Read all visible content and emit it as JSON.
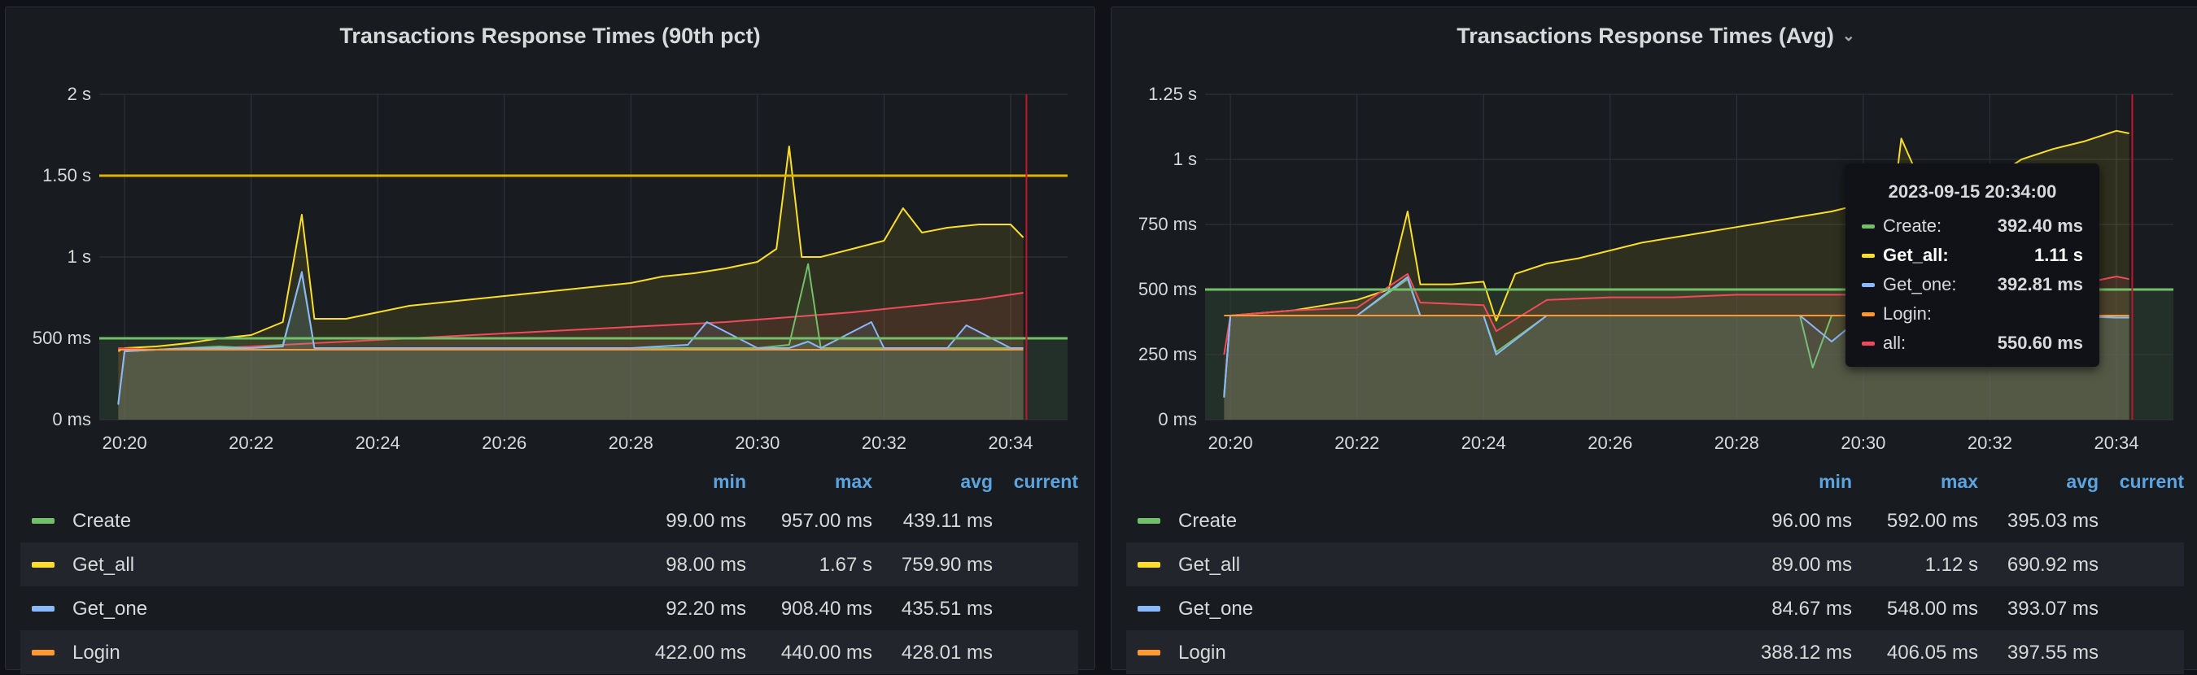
{
  "panels": [
    {
      "title": "Transactions Response Times (90th pct)",
      "has_menu": false,
      "legend_header": {
        "min": "min",
        "max": "max",
        "avg": "avg",
        "current": "current"
      },
      "legend": [
        {
          "name": "Create",
          "min": "99.00 ms",
          "max": "957.00 ms",
          "avg": "439.11 ms",
          "current": "",
          "color": "#73bf69"
        },
        {
          "name": "Get_all",
          "min": "98.00 ms",
          "max": "1.67 s",
          "avg": "759.90 ms",
          "current": "",
          "color": "#fade2a"
        },
        {
          "name": "Get_one",
          "min": "92.20 ms",
          "max": "908.40 ms",
          "avg": "435.51 ms",
          "current": "",
          "color": "#8ab8ff"
        },
        {
          "name": "Login",
          "min": "422.00 ms",
          "max": "440.00 ms",
          "avg": "428.01 ms",
          "current": "",
          "color": "#ff9830"
        }
      ]
    },
    {
      "title": "Transactions Response Times (Avg)",
      "has_menu": true,
      "legend_header": {
        "min": "min",
        "max": "max",
        "avg": "avg",
        "current": "current"
      },
      "legend": [
        {
          "name": "Create",
          "min": "96.00 ms",
          "max": "592.00 ms",
          "avg": "395.03 ms",
          "current": "",
          "color": "#73bf69"
        },
        {
          "name": "Get_all",
          "min": "89.00 ms",
          "max": "1.12 s",
          "avg": "690.92 ms",
          "current": "",
          "color": "#fade2a"
        },
        {
          "name": "Get_one",
          "min": "84.67 ms",
          "max": "548.00 ms",
          "avg": "393.07 ms",
          "current": "",
          "color": "#8ab8ff"
        },
        {
          "name": "Login",
          "min": "388.12 ms",
          "max": "406.05 ms",
          "avg": "397.55 ms",
          "current": "",
          "color": "#ff9830"
        }
      ],
      "tooltip": {
        "time": "2023-09-15 20:34:00",
        "rows": [
          {
            "label": "Create:",
            "value": "392.40 ms",
            "color": "#73bf69",
            "highlight": false
          },
          {
            "label": "Get_all:",
            "value": "1.11 s",
            "color": "#fade2a",
            "highlight": true
          },
          {
            "label": "Get_one:",
            "value": "392.81 ms",
            "color": "#8ab8ff",
            "highlight": false
          },
          {
            "label": "Login:",
            "value": "",
            "color": "#ff9830",
            "highlight": false
          },
          {
            "label": "all:",
            "value": "550.60 ms",
            "color": "#f2495c",
            "highlight": false
          }
        ]
      }
    }
  ],
  "chart_data": [
    {
      "type": "line",
      "title": "Transactions Response Times (90th pct)",
      "x_unit": "time (HH:MM)",
      "x_ticks": [
        "20:20",
        "20:22",
        "20:24",
        "20:26",
        "20:28",
        "20:30",
        "20:32",
        "20:34"
      ],
      "y_ticks": [
        "0 ms",
        "500 ms",
        "1 s",
        "1.50 s",
        "2 s"
      ],
      "ylim_ms": [
        0,
        2000
      ],
      "xlim_min": [
        19.6,
        34.9
      ],
      "thresholds_ms": [
        {
          "value": 500,
          "color": "#73bf69"
        },
        {
          "value": 1500,
          "color": "#e0b400"
        }
      ],
      "grid": true,
      "series": [
        {
          "name": "Get_all",
          "color": "#fade2a",
          "fill": true,
          "x": [
            19.9,
            20.0,
            20.5,
            21.0,
            21.5,
            22.0,
            22.5,
            22.8,
            23.0,
            23.5,
            24.0,
            24.5,
            25.0,
            25.5,
            26.0,
            26.5,
            27.0,
            27.5,
            28.0,
            28.5,
            29.0,
            29.5,
            30.0,
            30.3,
            30.5,
            30.7,
            31.0,
            31.5,
            32.0,
            32.3,
            32.6,
            33.0,
            33.5,
            34.0,
            34.2
          ],
          "y": [
            420,
            440,
            450,
            470,
            500,
            520,
            600,
            1260,
            620,
            620,
            660,
            700,
            720,
            740,
            760,
            780,
            800,
            820,
            840,
            880,
            900,
            930,
            970,
            1050,
            1680,
            1000,
            1000,
            1050,
            1100,
            1300,
            1150,
            1180,
            1200,
            1200,
            1120
          ]
        },
        {
          "name": "all",
          "color": "#f2495c",
          "fill": true,
          "x": [
            19.9,
            20.5,
            21.5,
            22.5,
            23.5,
            24.5,
            25.5,
            26.5,
            27.5,
            28.5,
            29.5,
            30.5,
            31.5,
            32.5,
            33.5,
            34.2
          ],
          "y": [
            440,
            430,
            440,
            460,
            480,
            500,
            520,
            540,
            560,
            580,
            600,
            630,
            660,
            700,
            740,
            780
          ]
        },
        {
          "name": "Create",
          "color": "#73bf69",
          "fill": true,
          "x": [
            19.9,
            20.0,
            20.5,
            21.0,
            21.5,
            22.0,
            22.5,
            22.8,
            23.0,
            23.5,
            24.0,
            25.0,
            26.0,
            27.0,
            28.0,
            28.9,
            29.2,
            30.0,
            30.5,
            30.8,
            31.0,
            32.0,
            32.8,
            33.0,
            34.0,
            34.2
          ],
          "y": [
            99,
            420,
            430,
            440,
            450,
            440,
            460,
            900,
            440,
            440,
            440,
            440,
            440,
            440,
            440,
            440,
            440,
            440,
            460,
            957,
            440,
            440,
            440,
            440,
            440,
            440
          ]
        },
        {
          "name": "Get_one",
          "color": "#8ab8ff",
          "fill": true,
          "x": [
            19.9,
            20.0,
            20.5,
            21.0,
            21.5,
            22.0,
            22.5,
            22.8,
            23.0,
            23.5,
            24.0,
            25.0,
            26.0,
            27.0,
            28.0,
            28.9,
            29.2,
            30.0,
            30.5,
            30.8,
            31.0,
            31.8,
            32.0,
            33.0,
            33.3,
            34.0,
            34.2
          ],
          "y": [
            92,
            420,
            430,
            440,
            440,
            440,
            450,
            908,
            440,
            440,
            440,
            440,
            440,
            440,
            440,
            460,
            600,
            440,
            440,
            480,
            440,
            600,
            440,
            440,
            580,
            440,
            440
          ]
        },
        {
          "name": "Login",
          "color": "#ff9830",
          "fill": false,
          "x": [
            19.9,
            34.2
          ],
          "y": [
            430,
            430
          ]
        }
      ]
    },
    {
      "type": "line",
      "title": "Transactions Response Times (Avg)",
      "x_unit": "time (HH:MM)",
      "x_ticks": [
        "20:20",
        "20:22",
        "20:24",
        "20:26",
        "20:28",
        "20:30",
        "20:32",
        "20:34"
      ],
      "y_ticks": [
        "0 ms",
        "250 ms",
        "500 ms",
        "750 ms",
        "1 s",
        "1.25 s"
      ],
      "ylim_ms": [
        0,
        1250
      ],
      "xlim_min": [
        19.6,
        34.9
      ],
      "thresholds_ms": [
        {
          "value": 500,
          "color": "#73bf69"
        }
      ],
      "grid": true,
      "series": [
        {
          "name": "Get_all",
          "color": "#fade2a",
          "fill": true,
          "x": [
            19.9,
            20.0,
            20.5,
            21.0,
            21.5,
            22.0,
            22.5,
            22.8,
            23.0,
            23.5,
            24.0,
            24.2,
            24.5,
            25.0,
            25.5,
            26.0,
            26.5,
            27.0,
            27.5,
            28.0,
            28.5,
            29.0,
            29.5,
            30.0,
            30.5,
            30.6,
            31.0,
            31.5,
            32.0,
            32.5,
            33.0,
            33.5,
            34.0,
            34.2
          ],
          "y": [
            89,
            400,
            410,
            420,
            440,
            460,
            500,
            800,
            520,
            520,
            530,
            380,
            560,
            600,
            620,
            650,
            680,
            700,
            720,
            740,
            760,
            780,
            800,
            830,
            880,
            1080,
            860,
            880,
            920,
            1000,
            1040,
            1070,
            1110,
            1100
          ]
        },
        {
          "name": "all",
          "color": "#f2495c",
          "fill": true,
          "x": [
            19.9,
            20.0,
            21.0,
            22.0,
            22.8,
            23.0,
            24.0,
            24.2,
            25.0,
            26.0,
            27.0,
            28.0,
            29.0,
            30.0,
            31.0,
            32.0,
            33.0,
            34.0,
            34.2
          ],
          "y": [
            250,
            400,
            420,
            430,
            560,
            450,
            440,
            340,
            460,
            470,
            470,
            480,
            480,
            480,
            490,
            500,
            500,
            550,
            540
          ]
        },
        {
          "name": "Create",
          "color": "#73bf69",
          "fill": true,
          "x": [
            19.9,
            20.0,
            21.0,
            22.0,
            22.8,
            23.0,
            24.0,
            24.2,
            25.0,
            26.0,
            27.0,
            28.0,
            29.0,
            29.2,
            29.5,
            30.0,
            31.0,
            32.0,
            33.0,
            34.0,
            34.2
          ],
          "y": [
            96,
            400,
            400,
            400,
            540,
            400,
            400,
            260,
            400,
            400,
            400,
            400,
            400,
            200,
            400,
            400,
            400,
            400,
            400,
            392,
            392
          ]
        },
        {
          "name": "Get_one",
          "color": "#8ab8ff",
          "fill": true,
          "x": [
            19.9,
            20.0,
            21.0,
            22.0,
            22.8,
            23.0,
            24.0,
            24.2,
            25.0,
            26.0,
            27.0,
            28.0,
            29.0,
            29.5,
            30.0,
            31.0,
            32.0,
            33.0,
            34.0,
            34.2
          ],
          "y": [
            85,
            400,
            400,
            400,
            548,
            400,
            400,
            250,
            400,
            400,
            400,
            400,
            400,
            300,
            400,
            400,
            400,
            400,
            393,
            393
          ]
        },
        {
          "name": "Login",
          "color": "#ff9830",
          "fill": false,
          "x": [
            19.9,
            34.2
          ],
          "y": [
            400,
            400
          ]
        }
      ]
    }
  ]
}
